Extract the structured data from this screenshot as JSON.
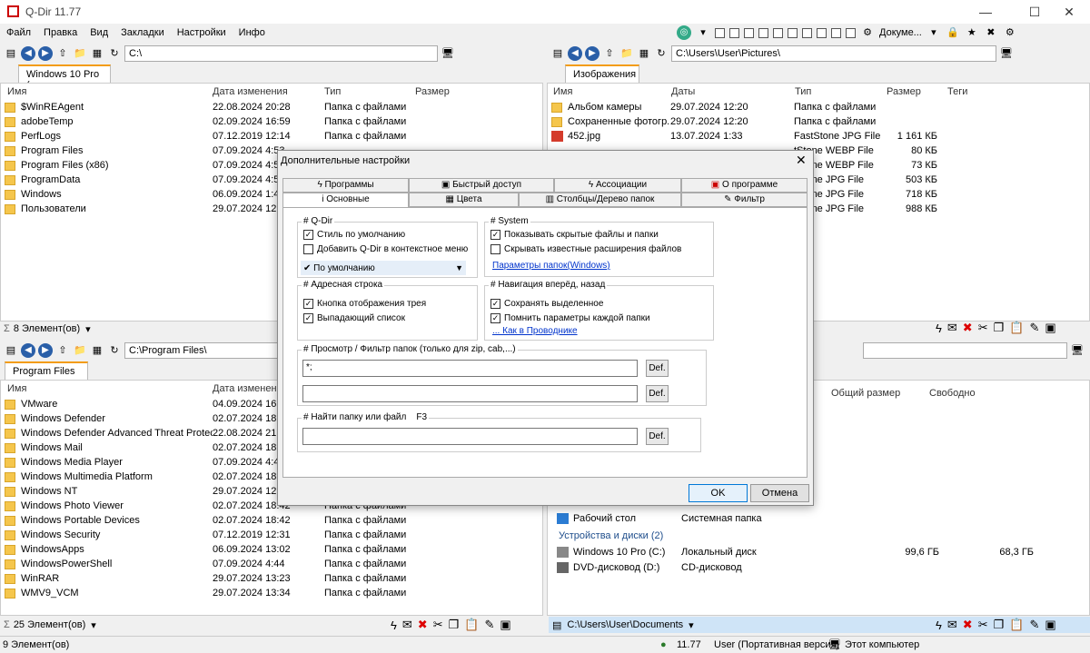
{
  "window": {
    "title": "Q-Dir 11.77",
    "min": "—",
    "max": "☐",
    "close": "✕"
  },
  "menu": [
    "Файл",
    "Правка",
    "Вид",
    "Закладки",
    "Настройки",
    "Инфо"
  ],
  "top_tools": {
    "docs_label": "Докуме..."
  },
  "pane_tl": {
    "address": "C:\\",
    "tab": "Windows 10 Pro ( ...",
    "headers": [
      "Имя",
      "Дата изменения",
      "Тип",
      "Размер"
    ],
    "rows": [
      {
        "name": "$WinREAgent",
        "date": "22.08.2024 20:28",
        "type": "Папка с файлами"
      },
      {
        "name": "adobeTemp",
        "date": "02.09.2024 16:59",
        "type": "Папка с файлами"
      },
      {
        "name": "PerfLogs",
        "date": "07.12.2019 12:14",
        "type": "Папка с файлами"
      },
      {
        "name": "Program Files",
        "date": "07.09.2024 4:53",
        "type": ""
      },
      {
        "name": "Program Files (x86)",
        "date": "07.09.2024 4:53",
        "type": ""
      },
      {
        "name": "ProgramData",
        "date": "07.09.2024 4:53",
        "type": ""
      },
      {
        "name": "Windows",
        "date": "06.09.2024 1:49",
        "type": ""
      },
      {
        "name": "Пользователи",
        "date": "29.07.2024 12:1",
        "type": ""
      }
    ],
    "status": "8 Элемент(ов)"
  },
  "pane_tr": {
    "address": "C:\\Users\\User\\Pictures\\",
    "tab": "Изображения",
    "headers": [
      "Имя",
      "Даты",
      "Тип",
      "Размер",
      "Теги"
    ],
    "rows": [
      {
        "name": "Альбом камеры",
        "date": "29.07.2024 12:20",
        "type": "Папка с файлами",
        "size": ""
      },
      {
        "name": "Сохраненные фотогр...",
        "date": "29.07.2024 12:20",
        "type": "Папка с файлами",
        "size": ""
      },
      {
        "name": "452.jpg",
        "date": "13.07.2024 1:33",
        "type": "FastStone JPG File",
        "size": "1 161 КБ"
      },
      {
        "name": "",
        "date": "",
        "type": "tStone WEBP File",
        "size": "80 КБ"
      },
      {
        "name": "",
        "date": "",
        "type": "tStone WEBP File",
        "size": "73 КБ"
      },
      {
        "name": "",
        "date": "",
        "type": "tStone JPG File",
        "size": "503 КБ"
      },
      {
        "name": "",
        "date": "",
        "type": "tStone JPG File",
        "size": "718 КБ"
      },
      {
        "name": "",
        "date": "",
        "type": "tStone JPG File",
        "size": "988 КБ"
      }
    ]
  },
  "pane_bl": {
    "address": "C:\\Program Files\\",
    "tab": "Program Files",
    "headers": [
      "Имя",
      "Дата изменения"
    ],
    "rows": [
      {
        "name": "VMware",
        "date": "04.09.2024 16:1",
        "type": ""
      },
      {
        "name": "Windows Defender",
        "date": "02.07.2024 18:4",
        "type": ""
      },
      {
        "name": "Windows Defender Advanced Threat Protect...",
        "date": "22.08.2024 21:1",
        "type": ""
      },
      {
        "name": "Windows Mail",
        "date": "02.07.2024 18:4",
        "type": ""
      },
      {
        "name": "Windows Media Player",
        "date": "07.09.2024 4:44",
        "type": ""
      },
      {
        "name": "Windows Multimedia Platform",
        "date": "02.07.2024 18:4",
        "type": ""
      },
      {
        "name": "Windows NT",
        "date": "29.07.2024 12:1",
        "type": ""
      },
      {
        "name": "Windows Photo Viewer",
        "date": "02.07.2024 18:42",
        "type": "Папка с файлами"
      },
      {
        "name": "Windows Portable Devices",
        "date": "02.07.2024 18:42",
        "type": "Папка с файлами"
      },
      {
        "name": "Windows Security",
        "date": "07.12.2019 12:31",
        "type": "Папка с файлами"
      },
      {
        "name": "WindowsApps",
        "date": "06.09.2024 13:02",
        "type": "Папка с файлами"
      },
      {
        "name": "WindowsPowerShell",
        "date": "07.09.2024 4:44",
        "type": "Папка с файлами"
      },
      {
        "name": "WinRAR",
        "date": "29.07.2024 13:23",
        "type": "Папка с файлами"
      },
      {
        "name": "WMV9_VCM",
        "date": "29.07.2024 13:34",
        "type": "Папка с файлами"
      }
    ],
    "status": "25 Элемент(ов)"
  },
  "pane_br": {
    "headers": [
      "Общий размер",
      "Свободно"
    ],
    "desktop": {
      "name": "Рабочий стол",
      "type": "Системная папка"
    },
    "group": "Устройства и диски (2)",
    "drives": [
      {
        "name": "Windows 10 Pro (C:)",
        "type": "Локальный диск",
        "total": "99,6 ГБ",
        "free": "68,3 ГБ"
      },
      {
        "name": "DVD-дисковод (D:)",
        "type": "CD-дисковод",
        "total": "",
        "free": ""
      }
    ],
    "path_status": "C:\\Users\\User\\Documents"
  },
  "statusbar": {
    "left": "9 Элемент(ов)",
    "version": "11.77",
    "user": "User (Портативная версия)",
    "computer": "Этот компьютер"
  },
  "dialog": {
    "title": "Дополнительные настройки",
    "tabs_row1": [
      "Программы",
      "Быстрый доступ",
      "Ассоциации",
      "О программе"
    ],
    "tabs_row2": [
      "Основные",
      "Цвета",
      "Столбцы/Дерево папок",
      "Фильтр"
    ],
    "qdir": {
      "label": "# Q-Dir",
      "opt1": "Стиль по умолчанию",
      "opt2": "Добавить Q-Dir в контекстное меню",
      "select": "По умолчанию"
    },
    "system": {
      "label": "# System",
      "opt1": "Показывать скрытые файлы и папки",
      "opt2": "Скрывать известные расширения файлов",
      "link": "Параметры папок(Windows)"
    },
    "address": {
      "label": "# Адресная строка",
      "opt1": "Кнопка отображения трея",
      "opt2": "Выпадающий список"
    },
    "nav": {
      "label": "# Навигация вперёд, назад",
      "opt1": "Сохранять выделенное",
      "opt2": "Помнить параметры каждой папки",
      "link": "... Как в Проводнике"
    },
    "filter": {
      "label": "# Просмотр / Фильтр папок (только для zip, cab,...)",
      "value1": "*;",
      "value2": "",
      "def": "Def."
    },
    "find": {
      "label": "# Найти папку или файл    F3",
      "value": ""
    },
    "ok": "OK",
    "cancel": "Отмена"
  }
}
